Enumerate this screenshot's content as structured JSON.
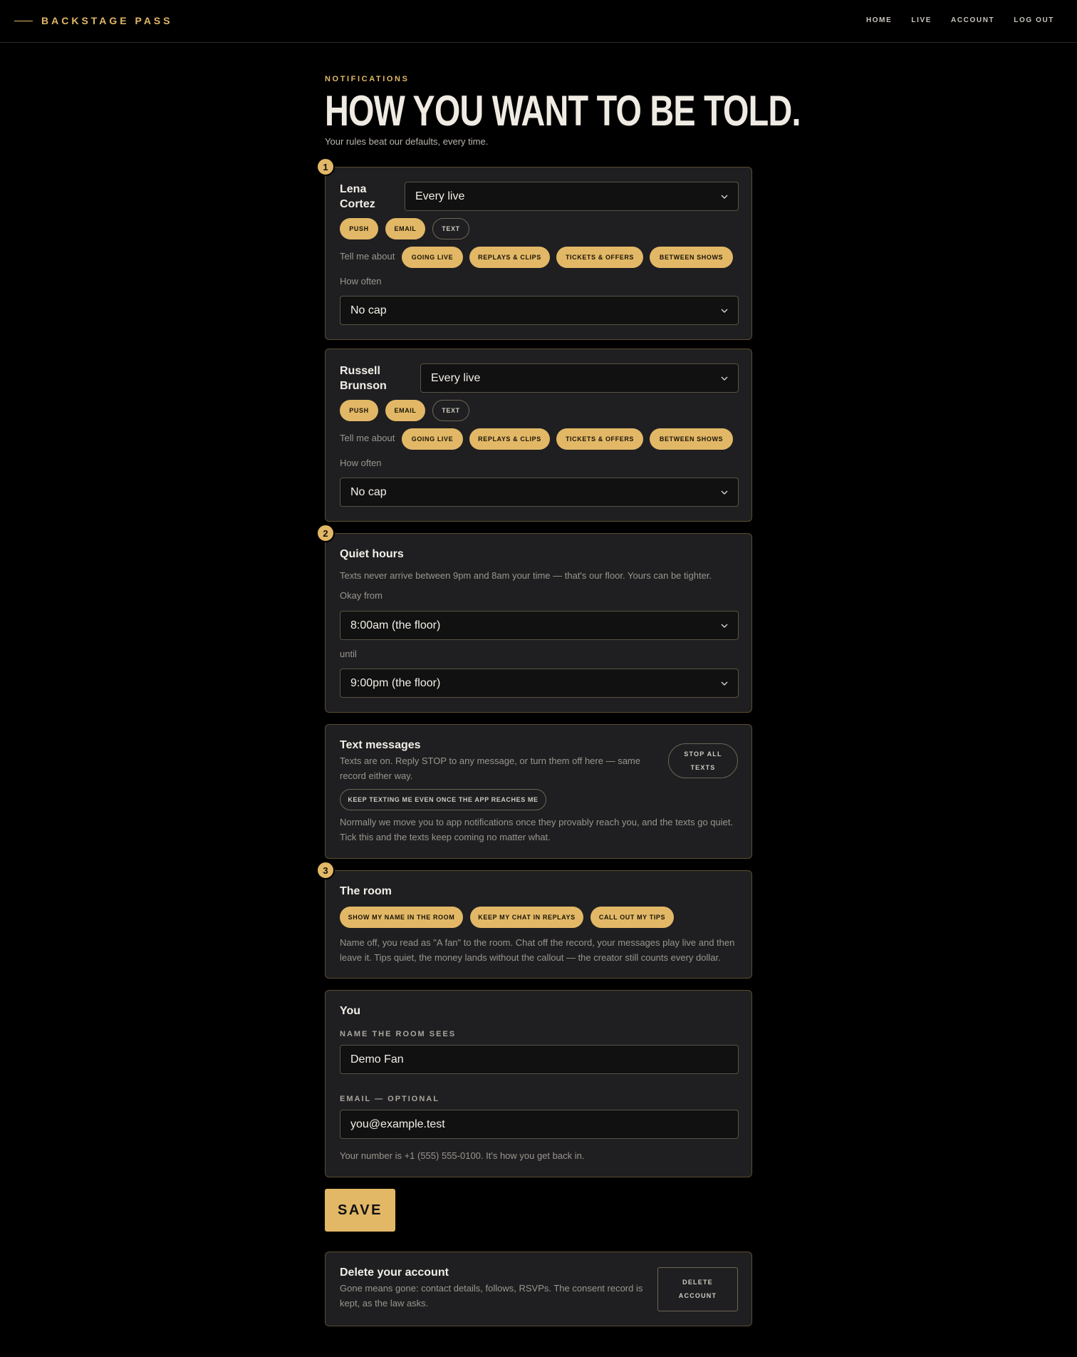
{
  "header": {
    "brand": "BACKSTAGE PASS",
    "nav": [
      "HOME",
      "LIVE",
      "ACCOUNT",
      "LOG OUT"
    ]
  },
  "page": {
    "eyebrow": "NOTIFICATIONS",
    "title": "HOW YOU WANT TO BE TOLD.",
    "subtitle": "Your rules beat our defaults, every time."
  },
  "steps": [
    "1",
    "2",
    "3"
  ],
  "creators": [
    {
      "name_line1": "Lena",
      "name_line2": "Cortez",
      "frequency": "Every live",
      "channels": [
        "PUSH",
        "EMAIL",
        "TEXT"
      ],
      "tell_me_label": "Tell me about",
      "topics": [
        "GOING LIVE",
        "REPLAYS & CLIPS",
        "TICKETS & OFFERS",
        "BETWEEN SHOWS"
      ],
      "how_often_label": "How often",
      "cap": "No cap"
    },
    {
      "name_line1": "Russell",
      "name_line2": "Brunson",
      "frequency": "Every live",
      "channels": [
        "PUSH",
        "EMAIL",
        "TEXT"
      ],
      "tell_me_label": "Tell me about",
      "topics": [
        "GOING LIVE",
        "REPLAYS & CLIPS",
        "TICKETS & OFFERS",
        "BETWEEN SHOWS"
      ],
      "how_often_label": "How often",
      "cap": "No cap"
    }
  ],
  "quiet_hours": {
    "title": "Quiet hours",
    "desc": "Texts never arrive between 9pm and 8am your time — that's our floor. Yours can be tighter.",
    "from_label": "Okay from",
    "from_value": "8:00am (the floor)",
    "until_label": "until",
    "until_value": "9:00pm (the floor)"
  },
  "text_messages": {
    "title": "Text messages",
    "desc_line1": "Texts are on. Reply STOP to any message, or turn them off here — same",
    "desc_line2": "record either way.",
    "stop_line1": "STOP ALL",
    "stop_line2": "TEXTS",
    "keep_label": "KEEP TEXTING ME EVEN ONCE THE APP REACHES ME",
    "note_line1": "Normally we move you to app notifications once they provably reach you, and the texts go quiet.",
    "note_line2": "Tick this and the texts keep coming no matter what."
  },
  "room": {
    "title": "The room",
    "toggles": [
      "SHOW MY NAME IN THE ROOM",
      "KEEP MY CHAT IN REPLAYS",
      "CALL OUT MY TIPS"
    ],
    "note_line1": "Name off, you read as \"A fan\" to the room. Chat off the record, your messages play live and then",
    "note_line2": "leave it. Tips quiet, the money lands without the callout — the creator still counts every dollar."
  },
  "you": {
    "title": "You",
    "name_label": "NAME THE ROOM SEES",
    "name_value": "Demo Fan",
    "email_label": "EMAIL — OPTIONAL",
    "email_value": "you@example.test",
    "number_note": "Your number is +1 (555) 555-0100. It's how you get back in."
  },
  "save_label": "SAVE",
  "delete": {
    "title": "Delete your account",
    "desc_line1": "Gone means gone: contact details, follows, RSVPs. The consent record is",
    "desc_line2": "kept, as the law asks.",
    "btn_line1": "DELETE",
    "btn_line2": "ACCOUNT"
  },
  "colors": {
    "accent": "#e2b867",
    "background": "#000000",
    "card": "#1f1f21"
  }
}
